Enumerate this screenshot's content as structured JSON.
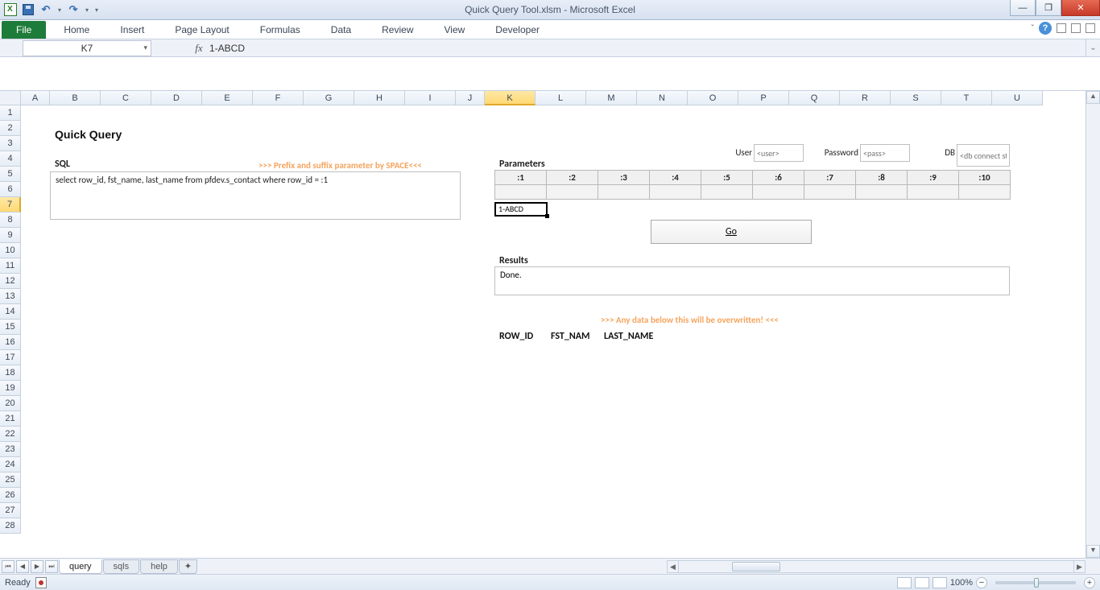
{
  "app": {
    "title": "Quick Query Tool.xlsm  -  Microsoft Excel"
  },
  "ribbon": {
    "file": "File",
    "tabs": [
      "Home",
      "Insert",
      "Page Layout",
      "Formulas",
      "Data",
      "Review",
      "View",
      "Developer"
    ]
  },
  "namebox": {
    "ref": "K7"
  },
  "formula": {
    "value": "1-ABCD"
  },
  "columns": [
    "A",
    "B",
    "C",
    "D",
    "E",
    "F",
    "G",
    "H",
    "I",
    "J",
    "K",
    "L",
    "M",
    "N",
    "O",
    "P",
    "Q",
    "R",
    "S",
    "T",
    "U"
  ],
  "rows_count": 28,
  "selected": {
    "col": "K",
    "row": 7
  },
  "sheet": {
    "title": "Quick Query",
    "sql_label": "SQL",
    "sql_hint": ">>> Prefix and suffix parameter by SPACE<<<",
    "sql_text": "select row_id, fst_name, last_name from pfdev.s_contact where row_id = :1",
    "params_label": "Parameters",
    "cred": {
      "user_label": "User",
      "user_ph": "<user>",
      "pass_label": "Password",
      "pass_ph": "<pass>",
      "db_label": "DB",
      "db_ph": "<db connect string>"
    },
    "param_headers": [
      ":1",
      ":2",
      ":3",
      ":4",
      ":5",
      ":6",
      ":7",
      ":8",
      ":9",
      ":10"
    ],
    "param_values": [
      "1-ABCD",
      "",
      "",
      "",
      "",
      "",
      "",
      "",
      "",
      ""
    ],
    "go_label": "Go",
    "results_label": "Results",
    "results_text": "Done.",
    "overwrite_warn": ">>> Any data below this will be overwritten! <<<",
    "result_cols": [
      "ROW_ID",
      "FST_NAME",
      "LAST_NAME"
    ],
    "result_cols_display": [
      "ROW_ID",
      "FST_NAM",
      "LAST_NAME"
    ]
  },
  "tabs": {
    "active": "query",
    "all": [
      "query",
      "sqls",
      "help"
    ]
  },
  "status": {
    "ready": "Ready",
    "zoom": "100%"
  }
}
